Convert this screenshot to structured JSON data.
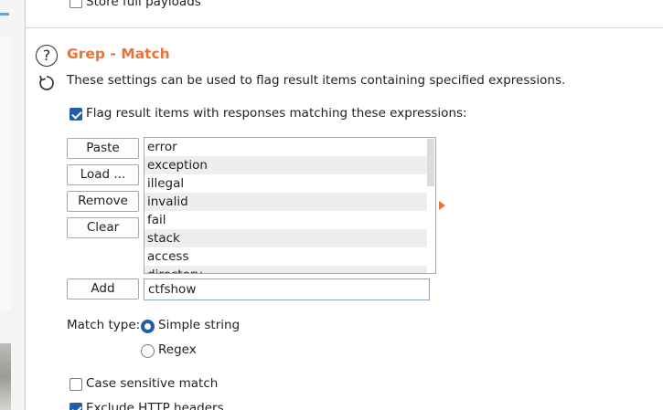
{
  "top_option": {
    "label": "Store full payloads",
    "checked": false
  },
  "section": {
    "title": "Grep - Match",
    "description": "These settings can be used to flag result items containing specified expressions.",
    "flag_checkbox": {
      "label": "Flag result items with responses matching these expressions:",
      "checked": true
    }
  },
  "buttons": {
    "paste": "Paste",
    "load": "Load ...",
    "remove": "Remove",
    "clear": "Clear",
    "add": "Add"
  },
  "expressions": [
    "error",
    "exception",
    "illegal",
    "invalid",
    "fail",
    "stack",
    "access",
    "directory"
  ],
  "add_field": {
    "value": "ctfshow"
  },
  "match_type": {
    "label": "Match type:",
    "options": [
      "Simple string",
      "Regex"
    ],
    "selected": "Simple string"
  },
  "case_sensitive": {
    "label": "Case sensitive match",
    "checked": false
  },
  "exclude_headers": {
    "label": "Exclude HTTP headers",
    "checked": true
  },
  "colors": {
    "accent": "#e8733a",
    "primary": "#1f5fa8"
  }
}
